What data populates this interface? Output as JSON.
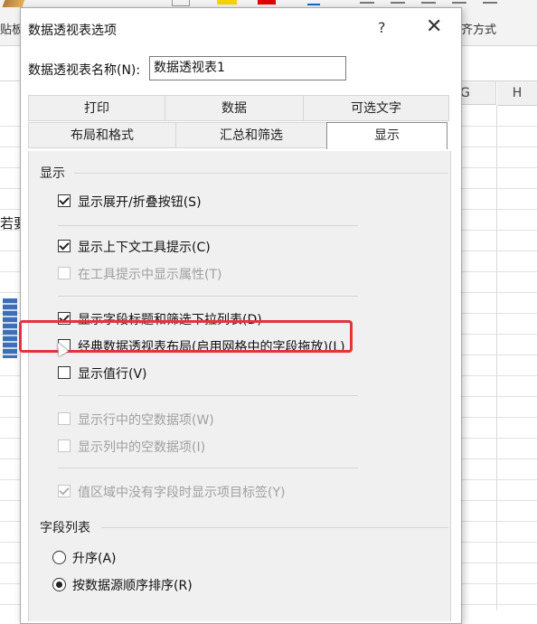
{
  "background": {
    "ribbon": {
      "paste_label": "贴板",
      "align_label": "齐方式"
    },
    "columns": [
      {
        "label": "G"
      },
      {
        "label": "H"
      }
    ],
    "left_text": "若要"
  },
  "dialog": {
    "title": "数据透视表选项",
    "help_label": "?",
    "close_label": "✕",
    "name_label": "数据透视表名称(N):",
    "name_value": "数据透视表1",
    "tabs_row1": [
      "打印",
      "数据",
      "可选文字"
    ],
    "tabs_row2": [
      "布局和格式",
      "汇总和筛选",
      "显示"
    ],
    "active_tab": "显示",
    "section_display": "显示",
    "options": [
      {
        "label": "显示展开/折叠按钮(S)",
        "checked": true,
        "disabled": false
      },
      {
        "label": "显示上下文工具提示(C)",
        "checked": true,
        "disabled": false
      },
      {
        "label": "在工具提示中显示属性(T)",
        "checked": false,
        "disabled": true
      },
      {
        "label": "显示字段标题和筛选下拉列表(D)",
        "checked": true,
        "disabled": false
      },
      {
        "label": "经典数据透视表布局(启用网格中的字段拖放)(L)",
        "checked": false,
        "disabled": false
      },
      {
        "label": "显示值行(V)",
        "checked": false,
        "disabled": false
      },
      {
        "label": "显示行中的空数据项(W)",
        "checked": false,
        "disabled": true
      },
      {
        "label": "显示列中的空数据项(I)",
        "checked": false,
        "disabled": true
      },
      {
        "label": "值区域中没有字段时显示项目标签(Y)",
        "checked": true,
        "disabled": true
      }
    ],
    "section_field_list": "字段列表",
    "radios": [
      {
        "label": "升序(A)",
        "checked": false
      },
      {
        "label": "按数据源顺序排序(R)",
        "checked": true
      }
    ]
  },
  "colors": {
    "highlight": "#e2343b",
    "panel_bg": "#f0f0f0"
  }
}
